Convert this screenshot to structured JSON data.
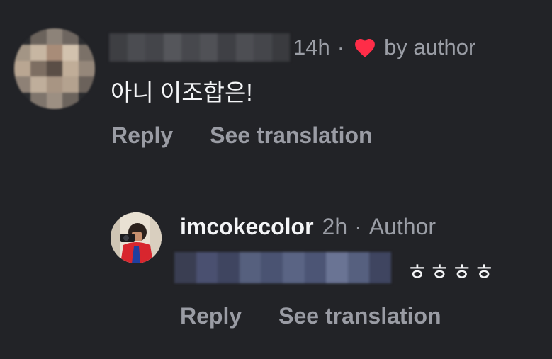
{
  "comment": {
    "time": "14h",
    "separator": "·",
    "liked_by": "by author",
    "text": "아니 이조합은!",
    "actions": {
      "reply": "Reply",
      "translate": "See translation"
    },
    "heart_color": "#ff2d48"
  },
  "reply": {
    "username": "imcokecolor",
    "time": "2h",
    "separator": "·",
    "badge": "Author",
    "text": "ㅎㅎㅎㅎ",
    "actions": {
      "reply": "Reply",
      "translate": "See translation"
    }
  },
  "colors": {
    "background": "#222327",
    "muted_text": "#9b9ea6",
    "primary_text": "#f4f5f7"
  }
}
